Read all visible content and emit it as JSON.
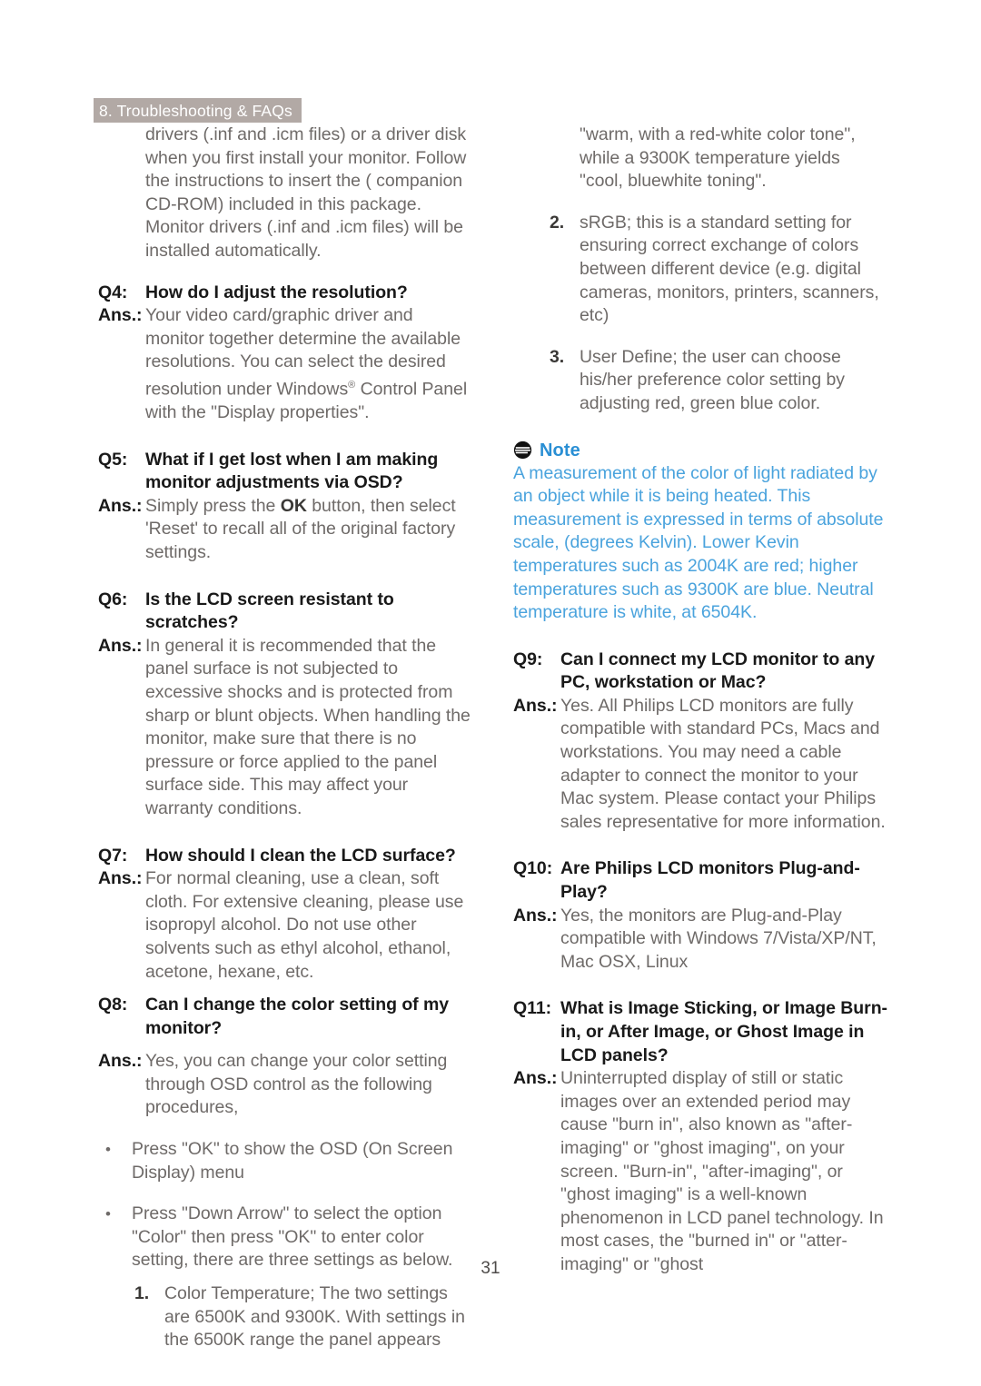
{
  "header": {
    "tab_label": "8. Troubleshooting & FAQs",
    "tab_bg": "#b2a9a5",
    "tab_color": "#ffffff"
  },
  "footer": {
    "page_number": "31"
  },
  "colors": {
    "question": "#191919",
    "answer": "#6e6a68",
    "note_title": "#2a8fd4",
    "note_body": "#4aa3dd"
  },
  "left_column": {
    "continued_paragraph": "drivers (.inf and .icm files) or a driver disk when you first install your monitor. Follow the instructions to insert the ( companion CD-ROM) included in this package. Monitor drivers (.inf and .icm files) will be installed automatically.",
    "q4": {
      "label": "Q4:",
      "question": "How do I adjust the resolution?",
      "ans_label": "Ans.:",
      "answer_pre": "Your video card/graphic driver and monitor together determine the available resolutions. You can select the desired resolution under Windows",
      "answer_sup": "®",
      "answer_post": " Control Panel with the \"Display properties\"."
    },
    "q5": {
      "label": "Q5:",
      "question": "What if I get lost when I am making monitor adjustments via OSD?",
      "ans_label": "Ans.:",
      "answer_pre": "Simply press the ",
      "answer_bold": "OK",
      "answer_post": " button, then select 'Reset' to recall all of the original factory settings."
    },
    "q6": {
      "label": "Q6:",
      "question": "Is the LCD screen resistant to scratches?",
      "ans_label": "Ans.:",
      "answer": "In general it is recommended that the panel surface is not subjected to excessive shocks and is protected from sharp or blunt objects. When handling the monitor, make sure that there is no pressure or force applied to the panel surface side. This may affect your warranty conditions."
    },
    "q7": {
      "label": "Q7:",
      "question": "How should I clean the LCD surface?",
      "ans_label": "Ans.:",
      "answer": "For normal cleaning, use a clean, soft cloth. For extensive cleaning, please use isopropyl alcohol. Do not use other solvents such as ethyl alcohol, ethanol, acetone, hexane, etc."
    },
    "q8": {
      "label": "Q8:",
      "question": "Can I change the color setting of my monitor?",
      "ans_label": "Ans.:",
      "answer": "Yes, you can change your color setting through OSD control as the following procedures,",
      "bullets": [
        {
          "mark": "•",
          "text": "Press \"OK\" to show the OSD (On Screen Display) menu"
        },
        {
          "mark": "•",
          "text": "Press \"Down Arrow\" to select the option \"Color\" then press \"OK\" to enter color setting, there are three settings as below."
        }
      ],
      "numbered": [
        {
          "mark": "1.",
          "text": "Color Temperature; The two settings are 6500K and 9300K. With settings in the 6500K range the panel appears"
        }
      ]
    }
  },
  "right_column": {
    "continued_numbered_1": "\"warm, with a red-white color tone\", while a 9300K temperature yields \"cool, bluewhite toning\".",
    "numbered": [
      {
        "mark": "2.",
        "text": "sRGB; this is a standard setting for ensuring correct exchange of colors between different device (e.g. digital cameras, monitors, printers, scanners, etc)"
      },
      {
        "mark": "3.",
        "text": "User Define; the user can choose his/her preference color setting by adjusting red, green blue color."
      }
    ],
    "note": {
      "icon": "note-icon",
      "title": "Note",
      "body": "A measurement of the color of light radiated by an object while it is being heated. This measurement is expressed in terms of absolute scale, (degrees Kelvin). Lower Kevin temperatures such as 2004K are red; higher temperatures such as 9300K are blue. Neutral temperature is white, at 6504K."
    },
    "q9": {
      "label": "Q9:",
      "question": "Can I connect my LCD monitor to any PC, workstation or Mac?",
      "ans_label": "Ans.:",
      "answer": "Yes. All Philips LCD monitors are fully compatible with standard PCs, Macs and workstations. You may need a cable adapter to connect the monitor to your Mac system. Please contact your Philips sales representative for more information."
    },
    "q10": {
      "label": "Q10:",
      "question": "Are Philips LCD monitors Plug-and-Play?",
      "ans_label": "Ans.:",
      "answer": "Yes, the monitors are Plug-and-Play compatible with Windows 7/Vista/XP/NT, Mac OSX, Linux"
    },
    "q11": {
      "label": "Q11:",
      "question": "What is Image Sticking, or Image Burn-in, or After Image, or Ghost Image in LCD panels?",
      "ans_label": "Ans.:",
      "answer": "Uninterrupted display of still or static images over an extended period may cause \"burn in\", also known as \"after-imaging\" or \"ghost imaging\", on your screen. \"Burn-in\", \"after-imaging\", or \"ghost imaging\" is a well-known phenomenon in LCD panel technology. In most cases, the \"burned in\" or \"atter-imaging\" or \"ghost"
    }
  }
}
